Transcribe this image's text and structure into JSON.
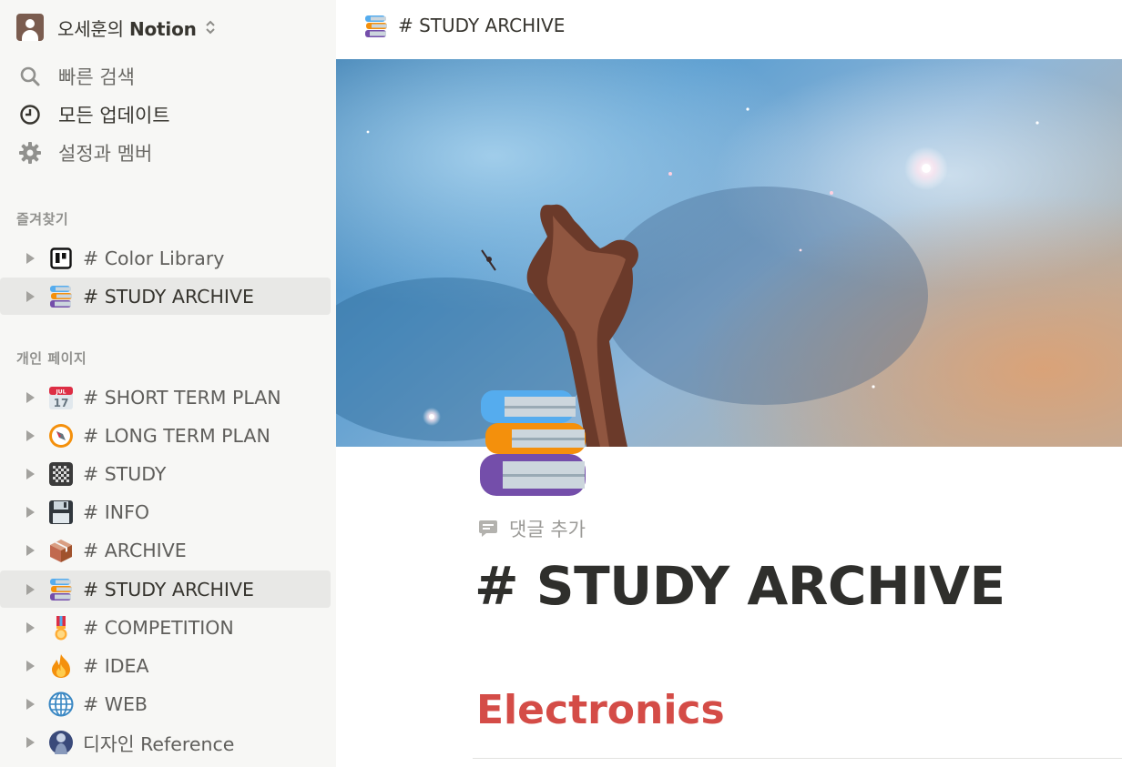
{
  "workspace": {
    "name_prefix": "오세훈의 ",
    "name_brand": "Notion"
  },
  "nav": [
    {
      "label": "빠른 검색",
      "icon": "search-icon"
    },
    {
      "label": "모든 업데이트",
      "icon": "clock-icon"
    },
    {
      "label": "설정과 멤버",
      "icon": "gear-icon"
    }
  ],
  "favorites": {
    "label": "즐겨찾기",
    "items": [
      {
        "label": "# Color Library",
        "icon": "board-icon"
      },
      {
        "label": "# STUDY ARCHIVE",
        "icon": "books-icon"
      }
    ]
  },
  "private": {
    "label": "개인 페이지",
    "items": [
      {
        "label": "# SHORT TERM PLAN",
        "icon": "calendar-icon"
      },
      {
        "label": "# LONG TERM PLAN",
        "icon": "compass-icon"
      },
      {
        "label": "# STUDY",
        "icon": "checkered-icon"
      },
      {
        "label": "# INFO",
        "icon": "floppy-disk-icon"
      },
      {
        "label": "# ARCHIVE",
        "icon": "package-icon"
      },
      {
        "label": "# STUDY ARCHIVE",
        "icon": "books-icon"
      },
      {
        "label": "# COMPETITION",
        "icon": "medal-icon"
      },
      {
        "label": "# IDEA",
        "icon": "fire-icon"
      },
      {
        "label": "# WEB",
        "icon": "globe-icon"
      },
      {
        "label": "디자인 Reference",
        "icon": "person-suit-icon"
      }
    ]
  },
  "topbar": {
    "breadcrumb": "# STUDY ARCHIVE"
  },
  "page": {
    "add_comment": "댓글 추가",
    "title": "# STUDY ARCHIVE",
    "heading": "Electronics"
  },
  "colors": {
    "sidebar_bg": "#f7f7f5",
    "active_bg": "#e8e8e6",
    "heading_red": "#d44c47",
    "text": "#37352f"
  }
}
